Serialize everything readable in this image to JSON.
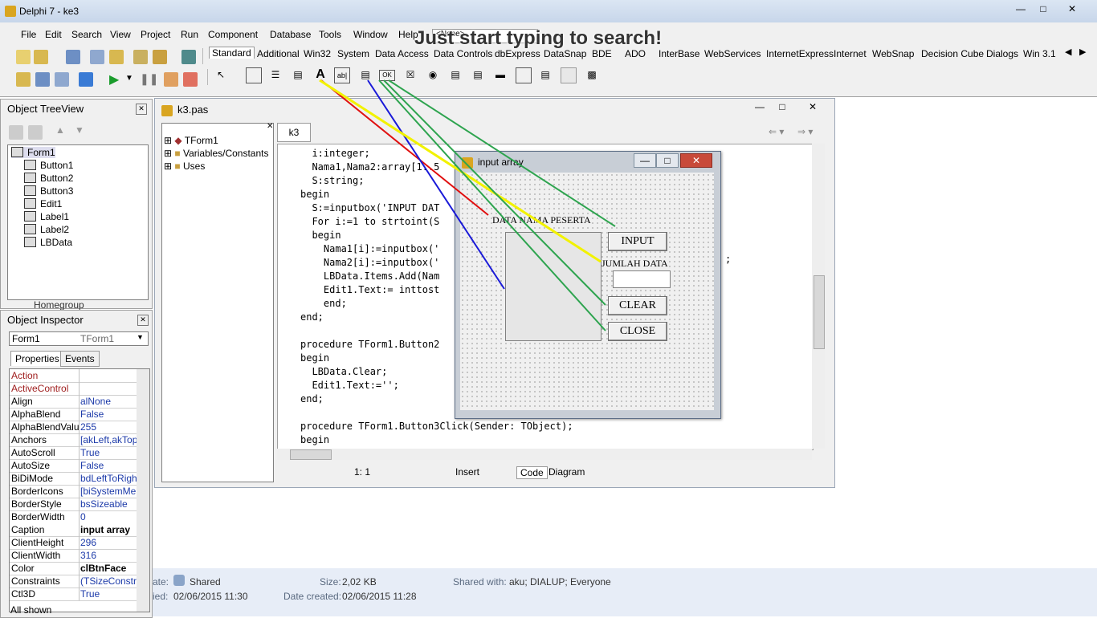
{
  "window": {
    "title": "Delphi 7 - ke3"
  },
  "menu": [
    "File",
    "Edit",
    "Search",
    "View",
    "Project",
    "Run",
    "Component",
    "Database",
    "Tools",
    "Window",
    "Help"
  ],
  "overlay": {
    "search_hint": "Just start typing to search!",
    "desktop_combo": "<None>"
  },
  "palette_tabs": [
    "Standard",
    "Additional",
    "Win32",
    "System",
    "Data Access",
    "Data Controls",
    "dbExpress",
    "DataSnap",
    "BDE",
    "ADO",
    "InterBase",
    "WebServices",
    "InternetExpress",
    "Internet",
    "WebSnap",
    "Decision Cube",
    "Dialogs",
    "Win 3.1"
  ],
  "treeview": {
    "title": "Object TreeView",
    "items": [
      "Form1",
      "Button1",
      "Button2",
      "Button3",
      "Edit1",
      "Label1",
      "Label2",
      "LBData"
    ]
  },
  "homegroup": "Homegroup",
  "inspector": {
    "title": "Object Inspector",
    "object_name": "Form1",
    "object_type": "TForm1",
    "tab_properties": "Properties",
    "tab_events": "Events",
    "rows": [
      {
        "name": "Action",
        "value": ""
      },
      {
        "name": "ActiveControl",
        "value": ""
      },
      {
        "name": "Align",
        "value": "alNone"
      },
      {
        "name": "AlphaBlend",
        "value": "False"
      },
      {
        "name": "AlphaBlendValu",
        "value": "255"
      },
      {
        "name": "Anchors",
        "value": "[akLeft,akTop"
      },
      {
        "name": "AutoScroll",
        "value": "True"
      },
      {
        "name": "AutoSize",
        "value": "False"
      },
      {
        "name": "BiDiMode",
        "value": "bdLeftToRight"
      },
      {
        "name": "BorderIcons",
        "value": "[biSystemMen"
      },
      {
        "name": "BorderStyle",
        "value": "bsSizeable"
      },
      {
        "name": "BorderWidth",
        "value": "0"
      },
      {
        "name": "Caption",
        "value": "input array"
      },
      {
        "name": "ClientHeight",
        "value": "296"
      },
      {
        "name": "ClientWidth",
        "value": "316"
      },
      {
        "name": "Color",
        "value": "clBtnFace"
      },
      {
        "name": "Constraints",
        "value": "(TSizeConstra"
      },
      {
        "name": "Ctl3D",
        "value": "True"
      }
    ],
    "footer": "All shown"
  },
  "editor": {
    "title": "k3.pas",
    "tab": "k3",
    "explorer": [
      "TForm1",
      "Variables/Constants",
      "Uses"
    ],
    "code": [
      "  i:integer;",
      "  Nama1,Nama2:array[1..5",
      "  S:string;",
      "begin",
      "  S:=inputbox('INPUT DAT",
      "  For i:=1 to strtoint(S",
      "  begin",
      "    Nama1[i]:=inputbox('",
      "    Nama2[i]:=inputbox('",
      "    LBData.Items.Add(Nam",
      "    Edit1.Text:= inttost",
      "    end;",
      "end;",
      "",
      "procedure TForm1.Button2",
      "begin",
      "  LBData.Clear;",
      "  Edit1.Text:='';",
      "end;",
      "",
      "procedure TForm1.Button3Click(Sender: TObject);",
      "begin"
    ],
    "code_overflow": ";",
    "status_pos": "1:  1",
    "status_mode": "Insert",
    "tab_code": "Code",
    "tab_diagram": "Diagram"
  },
  "form": {
    "caption": "input array",
    "label_peserta": "DATA NAMA PESERTA",
    "label_jumlah": "JUMLAH DATA",
    "btn_input": "INPUT",
    "btn_clear": "CLEAR",
    "btn_close": "CLOSE"
  },
  "file_details": {
    "state_label": "ate:",
    "state_value": "Shared",
    "modified_label": "ied:",
    "modified_value": "02/06/2015 11:30",
    "size_label": "Size:",
    "size_value": "2,02 KB",
    "created_label": "Date created:",
    "created_value": "02/06/2015 11:28",
    "shared_label": "Shared with:",
    "shared_value": "aku; DIALUP; Everyone"
  },
  "colors": {
    "arrow_red": "#e01010",
    "arrow_blue": "#1a1ad8",
    "arrow_yellow": "#f2f200",
    "arrow_green": "#2ea44f"
  }
}
